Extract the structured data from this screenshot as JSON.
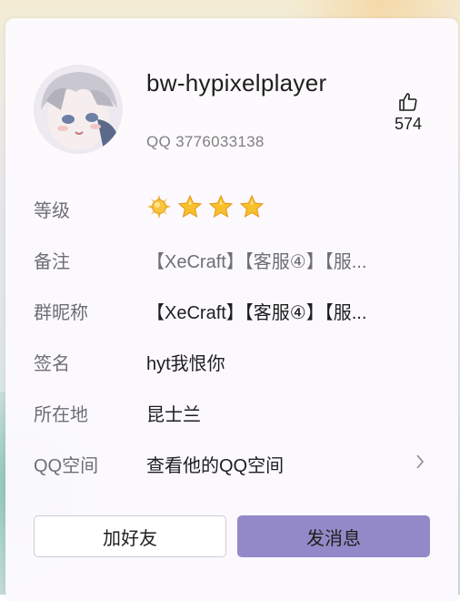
{
  "profile": {
    "username": "bw-hypixelplayer",
    "qq_number": "QQ 3776033138",
    "likes": "574"
  },
  "info": {
    "level_label": "等级",
    "level_icons": [
      "sun-icon",
      "star-icon",
      "star-icon",
      "star-icon"
    ],
    "remark_label": "备注",
    "remark_value": "【XeCraft】【客服④】【服...",
    "group_nick_label": "群昵称",
    "group_nick_value": "【XeCraft】【客服④】【服...",
    "signature_label": "签名",
    "signature_value": "hyt我恨你",
    "location_label": "所在地",
    "location_value": "昆士兰",
    "qzone_label": "QQ空间",
    "qzone_value": "查看他的QQ空间"
  },
  "actions": {
    "add_friend": "加好友",
    "send_message": "发消息"
  },
  "colors": {
    "primary_button": "#9489c8",
    "label_text": "#6e6e76",
    "value_text": "#1e1e1e"
  }
}
